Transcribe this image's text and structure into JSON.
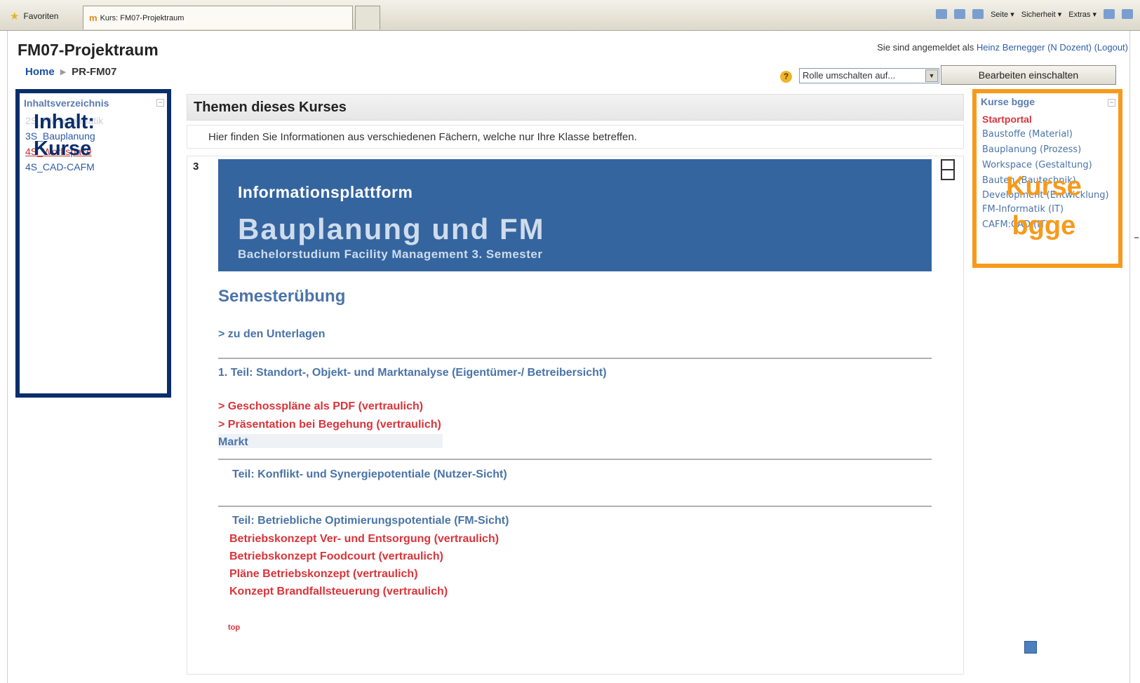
{
  "browser": {
    "favorites_label": "Favoriten",
    "tab_title": "Kurs: FM07-Projektraum",
    "tools": [
      "Seite ▾",
      "Sicherheit ▾",
      "Extras ▾"
    ]
  },
  "page": {
    "title": "FM07-Projektraum",
    "login_prefix": "Sie sind angemeldet als ",
    "login_user": "Heinz Bernegger (N Dozent)",
    "logout": "(Logout)"
  },
  "breadcrumb": {
    "home": "Home",
    "separator": "▶",
    "current": "PR-FM07"
  },
  "controls": {
    "role_select": "Rolle umschalten auf...",
    "edit_button": "Bearbeiten einschalten"
  },
  "left_block": {
    "title": "Inhaltsverzeichnis",
    "items": [
      {
        "label": "2S_FM-Informatik",
        "state": "dimmed"
      },
      {
        "label": "3S_Bauplanung",
        "state": "link"
      },
      {
        "label": "4S_Workspace",
        "state": "active"
      },
      {
        "label": "4S_CAD-CAFM",
        "state": "link"
      }
    ],
    "overlay_line1": "Inhalt:",
    "overlay_line2": "Kurse"
  },
  "center": {
    "header": "Themen dieses Kurses",
    "summary": "Hier finden Sie Informationen aus verschiedenen Fächern, welche nur Ihre Klasse betreffen.",
    "topic_number": "3",
    "banner": {
      "line1": "Informationsplattform",
      "line2": "Bauplanung und FM",
      "line3": "Bachelorstudium Facility Management 3. Semester"
    },
    "section_title": "Semesterübung",
    "docs_link": "> zu den Unterlagen",
    "part1": "1. Teil: Standort-, Objekt- und Marktanalyse (Eigentümer-/ Betreibersicht)",
    "part1_links": [
      "> Geschosspläne als PDF (vertraulich)",
      "> Präsentation bei Begehung (vertraulich)"
    ],
    "markt": "Markt",
    "part2": "Teil: Konflikt- und Synergiepotentiale (Nutzer-Sicht)",
    "part3": "Teil: Betriebliche Optimierungspotentiale (FM-Sicht)",
    "part3_links": [
      "Betriebskonzept Ver- und Entsorgung (vertraulich)",
      "Betriebskonzept Foodcourt (vertraulich)",
      "Pläne Betriebskonzept (vertraulich)",
      "Konzept Brandfallsteuerung (vertraulich)"
    ],
    "top_link": "top"
  },
  "right_block": {
    "title": "Kurse bgge",
    "items": [
      "Startportal",
      "Baustoffe (Material)",
      "Bauplanung (Prozess)",
      "Workspace (Gestaltung)",
      "Bauten (Bautechnik)",
      "Development (Entwicklung)",
      "FM-Informatik (IT)",
      "CAFM:CAD (IT)"
    ],
    "overlay_line1": "Kurse",
    "overlay_line2": "bgge"
  },
  "colors": {
    "left_frame": "#0a2d6b",
    "right_frame": "#f79a1b",
    "banner": "#35659f",
    "link_blue": "#4a74a8",
    "link_red": "#d9343a"
  }
}
